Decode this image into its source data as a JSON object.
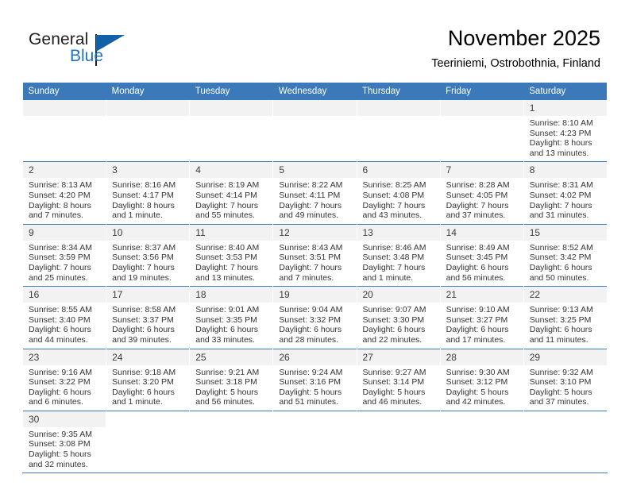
{
  "brand": {
    "name_part1": "General",
    "name_part2": "Blue",
    "logo_icon": "triangle-flag-icon",
    "accent_color": "#1161a8",
    "text_color": "#231f20"
  },
  "header": {
    "title": "November 2025",
    "subtitle": "Teeriniemi, Ostrobothnia, Finland"
  },
  "theme": {
    "header_row_bg": "#3b79b9",
    "header_row_text": "#ffffff",
    "daynum_bg": "#f2f2f2",
    "grid_line": "#3b79b9",
    "body_text": "#333333"
  },
  "calendar": {
    "weekday_headers": [
      "Sunday",
      "Monday",
      "Tuesday",
      "Wednesday",
      "Thursday",
      "Friday",
      "Saturday"
    ],
    "labels": {
      "sunrise": "Sunrise:",
      "sunset": "Sunset:",
      "daylight": "Daylight:"
    },
    "weeks": [
      [
        {
          "empty": true
        },
        {
          "empty": true
        },
        {
          "empty": true
        },
        {
          "empty": true
        },
        {
          "empty": true
        },
        {
          "empty": true
        },
        {
          "day": "1",
          "sunrise": "Sunrise: 8:10 AM",
          "sunset": "Sunset: 4:23 PM",
          "daylight": "Daylight: 8 hours and 13 minutes."
        }
      ],
      [
        {
          "day": "2",
          "sunrise": "Sunrise: 8:13 AM",
          "sunset": "Sunset: 4:20 PM",
          "daylight": "Daylight: 8 hours and 7 minutes."
        },
        {
          "day": "3",
          "sunrise": "Sunrise: 8:16 AM",
          "sunset": "Sunset: 4:17 PM",
          "daylight": "Daylight: 8 hours and 1 minute."
        },
        {
          "day": "4",
          "sunrise": "Sunrise: 8:19 AM",
          "sunset": "Sunset: 4:14 PM",
          "daylight": "Daylight: 7 hours and 55 minutes."
        },
        {
          "day": "5",
          "sunrise": "Sunrise: 8:22 AM",
          "sunset": "Sunset: 4:11 PM",
          "daylight": "Daylight: 7 hours and 49 minutes."
        },
        {
          "day": "6",
          "sunrise": "Sunrise: 8:25 AM",
          "sunset": "Sunset: 4:08 PM",
          "daylight": "Daylight: 7 hours and 43 minutes."
        },
        {
          "day": "7",
          "sunrise": "Sunrise: 8:28 AM",
          "sunset": "Sunset: 4:05 PM",
          "daylight": "Daylight: 7 hours and 37 minutes."
        },
        {
          "day": "8",
          "sunrise": "Sunrise: 8:31 AM",
          "sunset": "Sunset: 4:02 PM",
          "daylight": "Daylight: 7 hours and 31 minutes."
        }
      ],
      [
        {
          "day": "9",
          "sunrise": "Sunrise: 8:34 AM",
          "sunset": "Sunset: 3:59 PM",
          "daylight": "Daylight: 7 hours and 25 minutes."
        },
        {
          "day": "10",
          "sunrise": "Sunrise: 8:37 AM",
          "sunset": "Sunset: 3:56 PM",
          "daylight": "Daylight: 7 hours and 19 minutes."
        },
        {
          "day": "11",
          "sunrise": "Sunrise: 8:40 AM",
          "sunset": "Sunset: 3:53 PM",
          "daylight": "Daylight: 7 hours and 13 minutes."
        },
        {
          "day": "12",
          "sunrise": "Sunrise: 8:43 AM",
          "sunset": "Sunset: 3:51 PM",
          "daylight": "Daylight: 7 hours and 7 minutes."
        },
        {
          "day": "13",
          "sunrise": "Sunrise: 8:46 AM",
          "sunset": "Sunset: 3:48 PM",
          "daylight": "Daylight: 7 hours and 1 minute."
        },
        {
          "day": "14",
          "sunrise": "Sunrise: 8:49 AM",
          "sunset": "Sunset: 3:45 PM",
          "daylight": "Daylight: 6 hours and 56 minutes."
        },
        {
          "day": "15",
          "sunrise": "Sunrise: 8:52 AM",
          "sunset": "Sunset: 3:42 PM",
          "daylight": "Daylight: 6 hours and 50 minutes."
        }
      ],
      [
        {
          "day": "16",
          "sunrise": "Sunrise: 8:55 AM",
          "sunset": "Sunset: 3:40 PM",
          "daylight": "Daylight: 6 hours and 44 minutes."
        },
        {
          "day": "17",
          "sunrise": "Sunrise: 8:58 AM",
          "sunset": "Sunset: 3:37 PM",
          "daylight": "Daylight: 6 hours and 39 minutes."
        },
        {
          "day": "18",
          "sunrise": "Sunrise: 9:01 AM",
          "sunset": "Sunset: 3:35 PM",
          "daylight": "Daylight: 6 hours and 33 minutes."
        },
        {
          "day": "19",
          "sunrise": "Sunrise: 9:04 AM",
          "sunset": "Sunset: 3:32 PM",
          "daylight": "Daylight: 6 hours and 28 minutes."
        },
        {
          "day": "20",
          "sunrise": "Sunrise: 9:07 AM",
          "sunset": "Sunset: 3:30 PM",
          "daylight": "Daylight: 6 hours and 22 minutes."
        },
        {
          "day": "21",
          "sunrise": "Sunrise: 9:10 AM",
          "sunset": "Sunset: 3:27 PM",
          "daylight": "Daylight: 6 hours and 17 minutes."
        },
        {
          "day": "22",
          "sunrise": "Sunrise: 9:13 AM",
          "sunset": "Sunset: 3:25 PM",
          "daylight": "Daylight: 6 hours and 11 minutes."
        }
      ],
      [
        {
          "day": "23",
          "sunrise": "Sunrise: 9:16 AM",
          "sunset": "Sunset: 3:22 PM",
          "daylight": "Daylight: 6 hours and 6 minutes."
        },
        {
          "day": "24",
          "sunrise": "Sunrise: 9:18 AM",
          "sunset": "Sunset: 3:20 PM",
          "daylight": "Daylight: 6 hours and 1 minute."
        },
        {
          "day": "25",
          "sunrise": "Sunrise: 9:21 AM",
          "sunset": "Sunset: 3:18 PM",
          "daylight": "Daylight: 5 hours and 56 minutes."
        },
        {
          "day": "26",
          "sunrise": "Sunrise: 9:24 AM",
          "sunset": "Sunset: 3:16 PM",
          "daylight": "Daylight: 5 hours and 51 minutes."
        },
        {
          "day": "27",
          "sunrise": "Sunrise: 9:27 AM",
          "sunset": "Sunset: 3:14 PM",
          "daylight": "Daylight: 5 hours and 46 minutes."
        },
        {
          "day": "28",
          "sunrise": "Sunrise: 9:30 AM",
          "sunset": "Sunset: 3:12 PM",
          "daylight": "Daylight: 5 hours and 42 minutes."
        },
        {
          "day": "29",
          "sunrise": "Sunrise: 9:32 AM",
          "sunset": "Sunset: 3:10 PM",
          "daylight": "Daylight: 5 hours and 37 minutes."
        }
      ],
      [
        {
          "day": "30",
          "sunrise": "Sunrise: 9:35 AM",
          "sunset": "Sunset: 3:08 PM",
          "daylight": "Daylight: 5 hours and 32 minutes."
        },
        {
          "blank": true
        },
        {
          "blank": true
        },
        {
          "blank": true
        },
        {
          "blank": true
        },
        {
          "blank": true
        },
        {
          "blank": true
        }
      ]
    ]
  }
}
